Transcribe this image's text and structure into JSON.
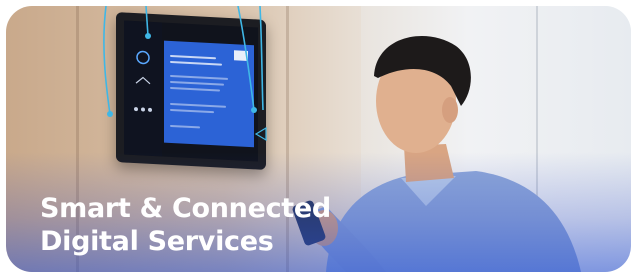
{
  "hero": {
    "headline_line1": "Smart & Connected",
    "headline_line2": "Digital Services"
  },
  "colors": {
    "headline": "#ffffff",
    "accent_overlay": "#2850c8",
    "wire": "#3fb7e6"
  }
}
